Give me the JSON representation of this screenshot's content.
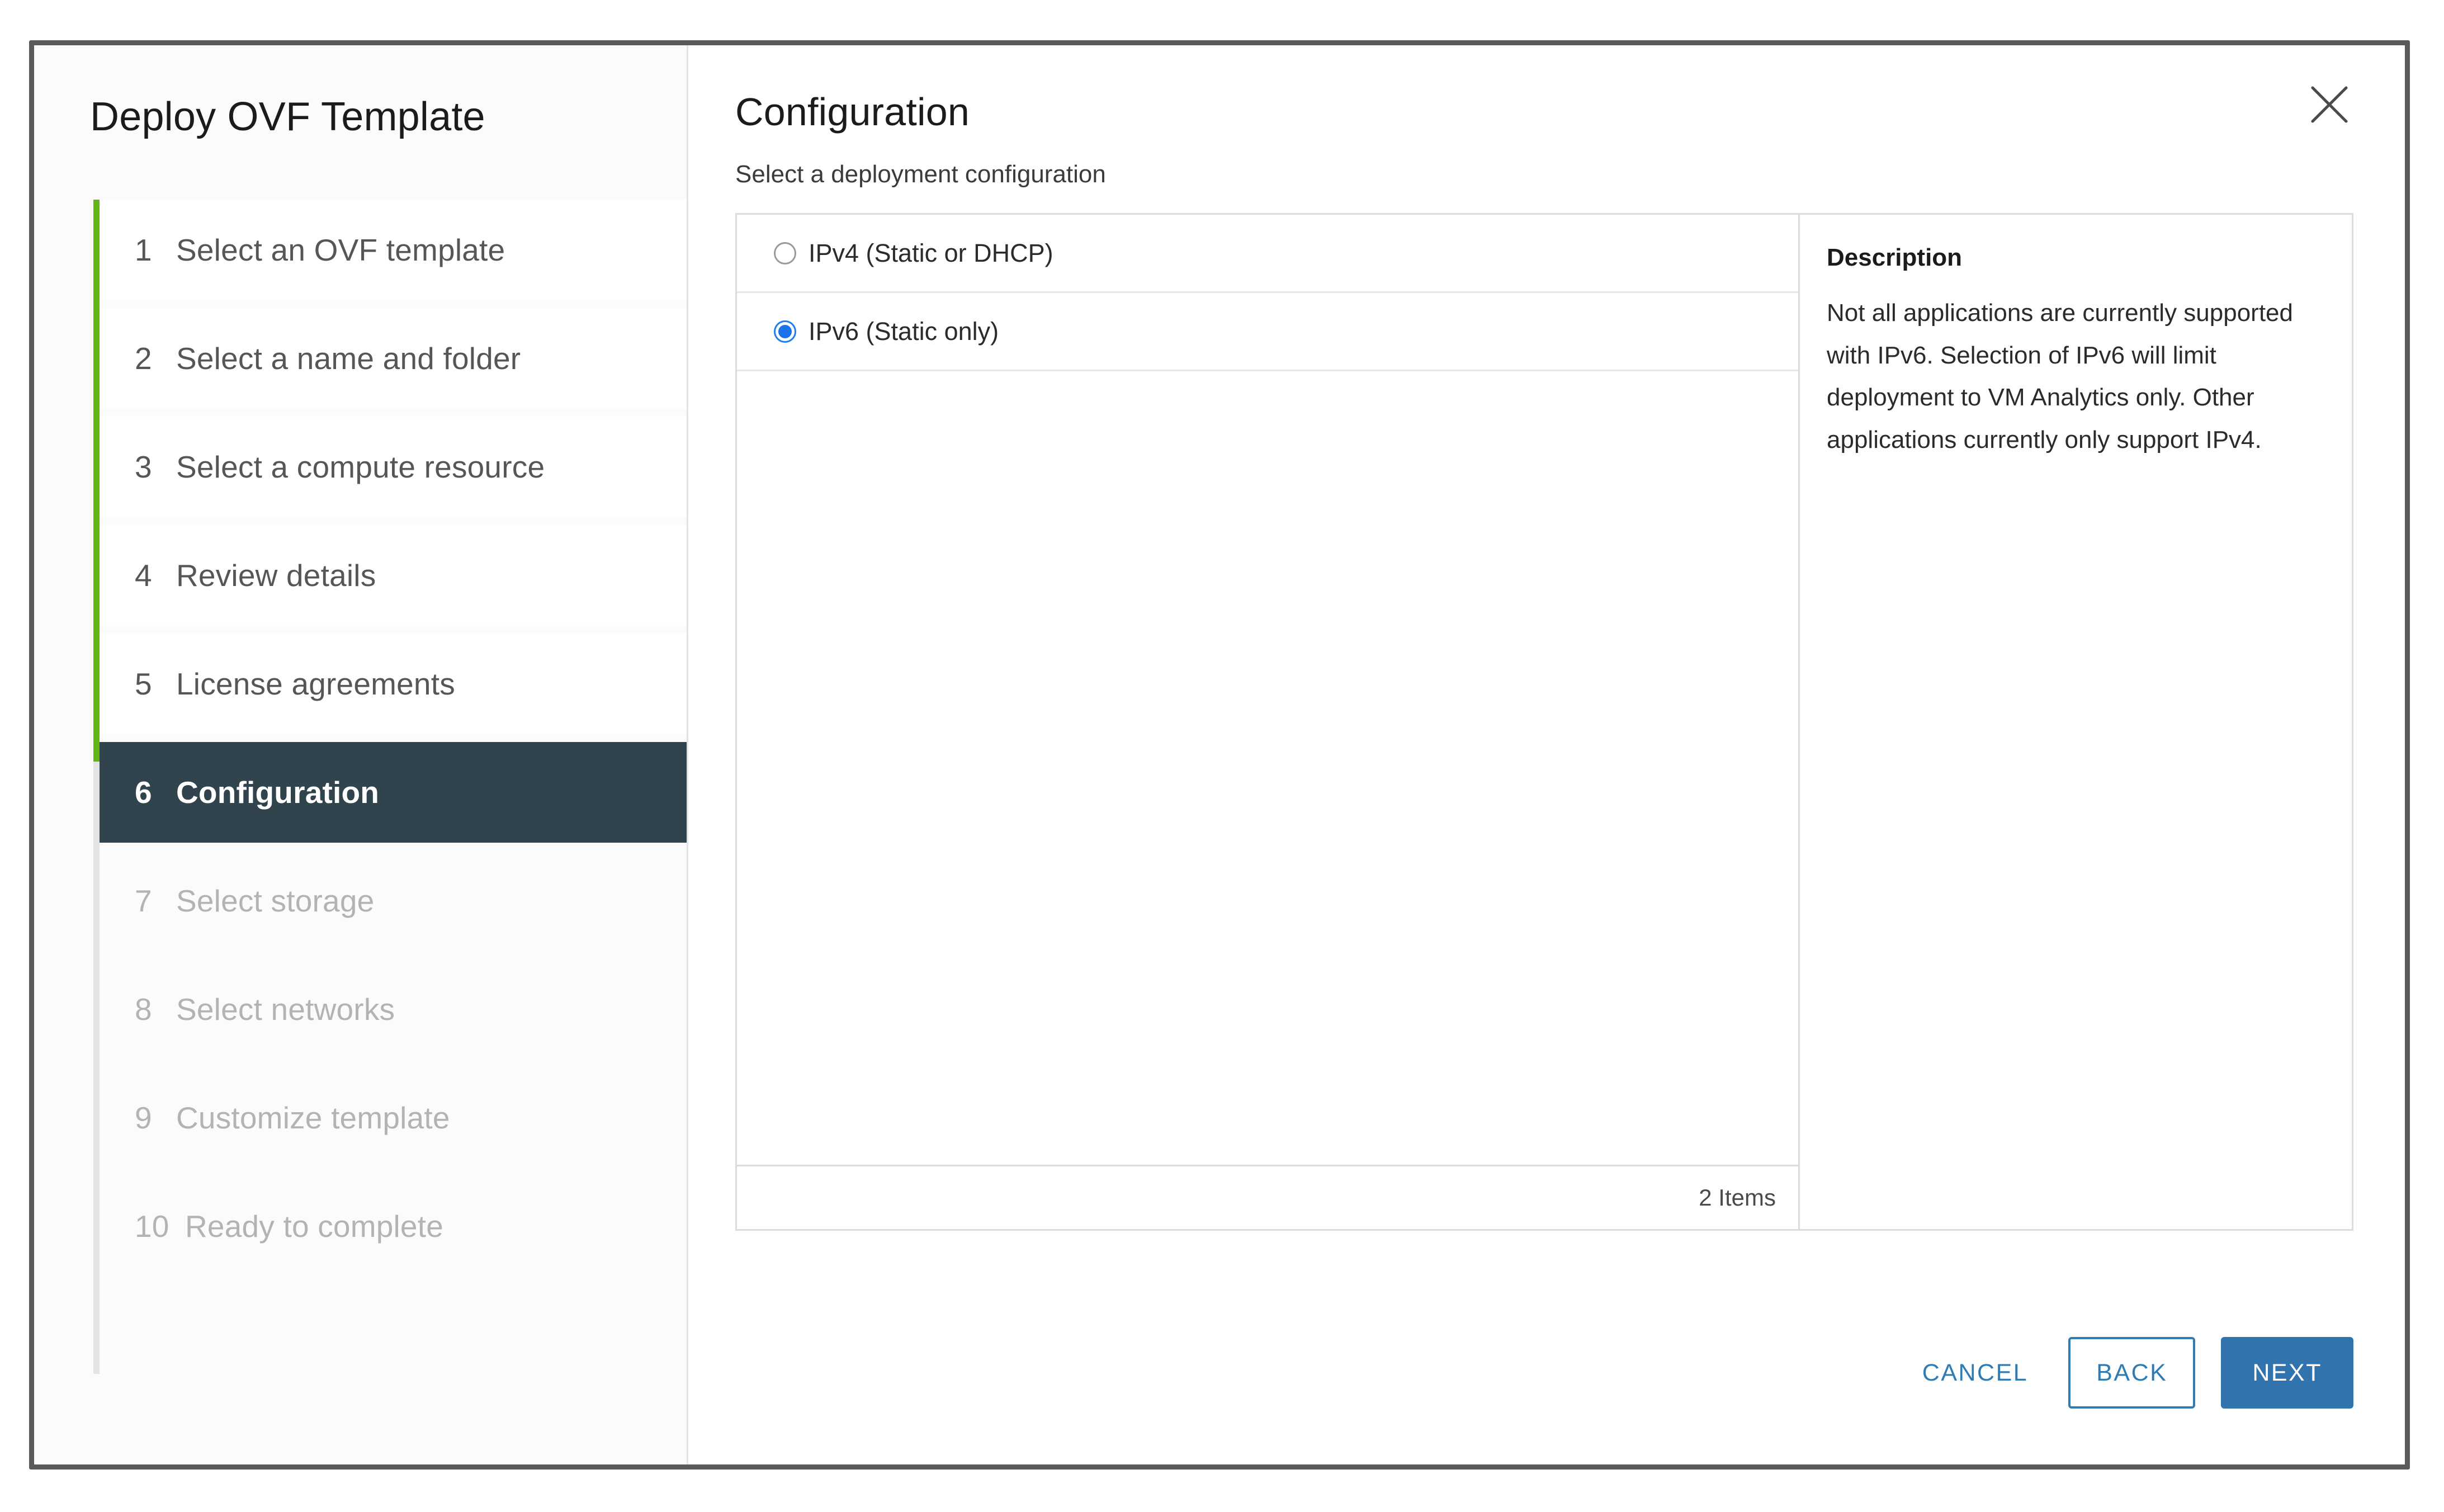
{
  "window": {
    "title": "Deploy OVF Template",
    "close_icon": "close-icon"
  },
  "sidebar": {
    "steps": [
      {
        "num": "1",
        "label": "Select an OVF template",
        "state": "complete"
      },
      {
        "num": "2",
        "label": "Select a name and folder",
        "state": "complete"
      },
      {
        "num": "3",
        "label": "Select a compute resource",
        "state": "complete"
      },
      {
        "num": "4",
        "label": "Review details",
        "state": "complete"
      },
      {
        "num": "5",
        "label": "License agreements",
        "state": "complete"
      },
      {
        "num": "6",
        "label": "Configuration",
        "state": "active"
      },
      {
        "num": "7",
        "label": "Select storage",
        "state": "disabled"
      },
      {
        "num": "8",
        "label": "Select networks",
        "state": "disabled"
      },
      {
        "num": "9",
        "label": "Customize template",
        "state": "disabled"
      },
      {
        "num": "10",
        "label": "Ready to complete",
        "state": "disabled"
      }
    ]
  },
  "content": {
    "title": "Configuration",
    "subtitle": "Select a deployment configuration",
    "options": [
      {
        "label": "IPv4 (Static or DHCP)",
        "selected": false
      },
      {
        "label": "IPv6 (Static only)",
        "selected": true
      }
    ],
    "item_count": "2 Items",
    "description": {
      "heading": "Description",
      "body": "Not all applications are currently supported with IPv6. Selection of IPv6 will limit deployment to VM Analytics only. Other applications currently only support IPv4."
    }
  },
  "footer": {
    "cancel_label": "CANCEL",
    "back_label": "BACK",
    "next_label": "NEXT"
  },
  "colors": {
    "accent_green": "#62b515",
    "active_step_bg": "#31444e",
    "primary_blue": "#3174ad",
    "link_blue": "#2f7cb4",
    "radio_blue": "#1a73e8"
  }
}
